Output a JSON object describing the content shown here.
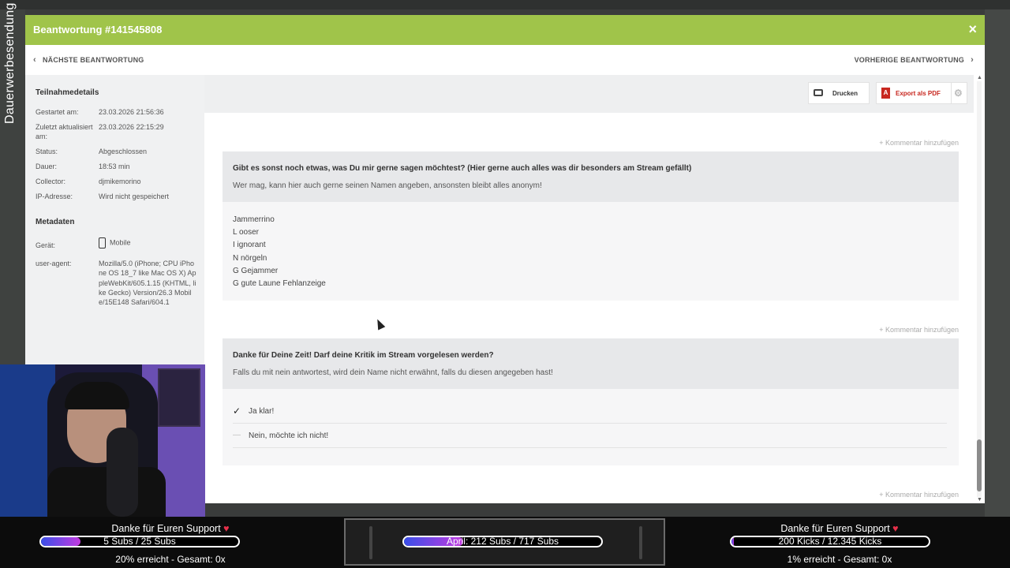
{
  "side_text": "Dauerwerbesendung",
  "modal": {
    "title": "Beantwortung #141545808",
    "close_label": "×",
    "nav_prev": "NÄCHSTE BEANTWORTUNG",
    "nav_next": "VORHERIGE BEANTWORTUNG"
  },
  "sidebar": {
    "participation_heading": "Teilnahmedetails",
    "details": [
      {
        "label": "Gestartet am:",
        "value": "23.03.2026 21:56:36"
      },
      {
        "label": "Zuletzt aktualisiert am:",
        "value": "23.03.2026 22:15:29"
      },
      {
        "label": "Status:",
        "value": "Abgeschlossen"
      },
      {
        "label": "Dauer:",
        "value": "18:53 min"
      },
      {
        "label": "Collector:",
        "value": "djmikemorino"
      },
      {
        "label": "IP-Adresse:",
        "value": "Wird nicht gespeichert"
      }
    ],
    "metadata_heading": "Metadaten",
    "device_label": "Gerät:",
    "device_value": "Mobile",
    "useragent_label": "user-agent:",
    "useragent_value": "Mozilla/5.0 (iPhone; CPU iPhone OS 18_7 like Mac OS X) AppleWebKit/605.1.15 (KHTML, like Gecko) Version/26.3 Mobile/15E148 Safari/604.1"
  },
  "toolbar": {
    "print_label": "Drucken",
    "pdf_label": "Export als PDF",
    "pdf_icon_text": "A"
  },
  "add_comment": "+ Kommentar hinzufügen",
  "question1": {
    "title": "Gibt es sonst noch etwas, was Du mir gerne sagen möchtest? (Hier gerne auch alles was dir besonders am Stream gefällt)",
    "subtitle": "Wer mag, kann hier auch gerne seinen Namen angeben, ansonsten bleibt alles anonym!",
    "answer_lines": [
      "Jammerrino",
      "L ooser",
      "I ignorant",
      "N nörgeln",
      "G Gejammer",
      "G gute Laune Fehlanzeige"
    ]
  },
  "question2": {
    "title": "Danke für Deine Zeit! Darf deine Kritik im Stream vorgelesen werden?",
    "subtitle": "Falls du mit nein antwortest, wird dein Name nicht erwähnt, falls du diesen angegeben hast!",
    "options": [
      {
        "label": "Ja klar!",
        "selected": true,
        "mark": "✓"
      },
      {
        "label": "Nein, möchte ich nicht!",
        "selected": false,
        "mark": "—"
      }
    ]
  },
  "overlay": {
    "left": {
      "title": "Danke für Euren Support",
      "heart": "♥",
      "bar_text": "5 Subs / 25 Subs",
      "progress_percent": 20,
      "footer": "20% erreicht - Gesamt: 0x"
    },
    "center": {
      "bar_text": "April: 212 Subs / 717 Subs",
      "progress_percent": 30
    },
    "right": {
      "title": "Danke für Euren Support",
      "heart": "♥",
      "bar_text": "200 Kicks / 12.345 Kicks",
      "progress_percent": 1,
      "footer": "1% erreicht - Gesamt: 0x"
    }
  },
  "colors": {
    "header_green": "#a0c44a",
    "pdf_red": "#c8271f",
    "heart_red": "#e8304a"
  }
}
